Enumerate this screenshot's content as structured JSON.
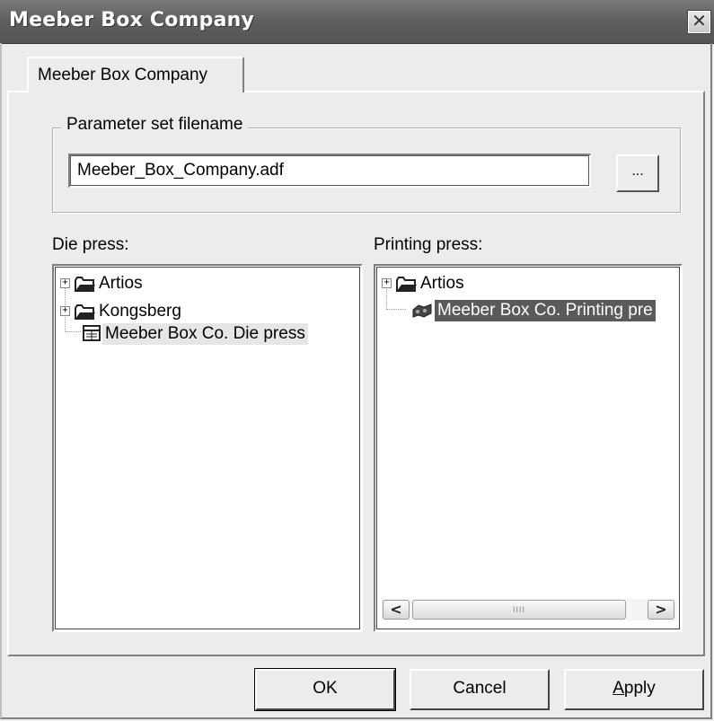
{
  "window": {
    "title": "Meeber Box Company",
    "close_glyph": "✕"
  },
  "tab": {
    "label": "Meeber Box Company"
  },
  "parameter_group": {
    "legend": "Parameter set filename",
    "filename_value": "Meeber_Box_Company.adf",
    "browse_label": "..."
  },
  "die_press": {
    "label": "Die press:",
    "items": [
      {
        "label": "Artios",
        "icon": "folder-icon",
        "expandable": true
      },
      {
        "label": "Kongsberg",
        "icon": "folder-icon",
        "expandable": true
      },
      {
        "label": "Meeber Box Co. Die press",
        "icon": "die-press-icon",
        "expandable": false,
        "selected": true
      }
    ]
  },
  "printing_press": {
    "label": "Printing press:",
    "items": [
      {
        "label": "Artios",
        "icon": "folder-icon",
        "expandable": true
      },
      {
        "label": "Meeber Box Co. Printing pre",
        "icon": "printing-press-icon",
        "expandable": false,
        "selected": true
      }
    ],
    "scrollbar": {
      "left_arrow": "<",
      "right_arrow": ">",
      "thumb_grip": "IIII"
    }
  },
  "buttons": {
    "ok": "OK",
    "cancel": "Cancel",
    "apply": "Apply"
  },
  "colors": {
    "titlebar": "#5e5e5e",
    "selection_active": "#5a5a5a",
    "selection_inactive": "#e6e6e6",
    "dialog_bg": "#ececec"
  }
}
